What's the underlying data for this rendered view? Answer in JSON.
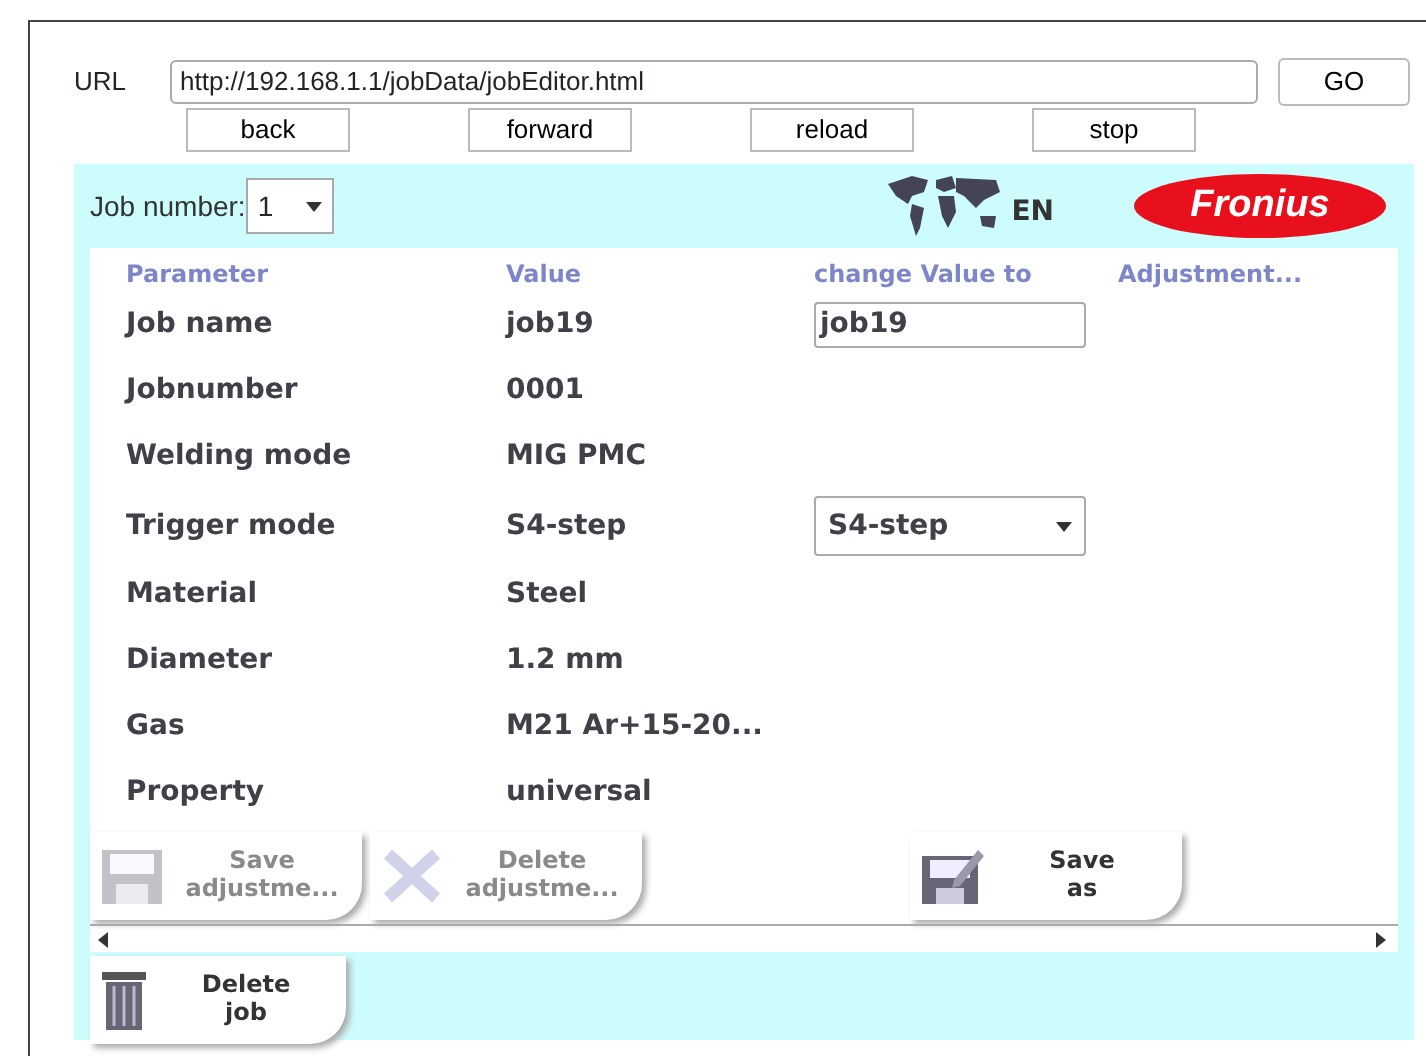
{
  "browser": {
    "url_label": "URL",
    "url": "http://192.168.1.1/jobData/jobEditor.html",
    "go": "GO",
    "nav_buttons": [
      "back",
      "forward",
      "reload",
      "stop"
    ]
  },
  "header": {
    "job_number_label": "Job number:",
    "job_number": "1",
    "language": "EN",
    "logo": "Fronius"
  },
  "table": {
    "columns": [
      "Parameter",
      "Value",
      "change Value to",
      "Adjustment..."
    ],
    "rows": [
      {
        "parameter": "Job name",
        "value": "job19",
        "change": {
          "kind": "text",
          "value": "job19"
        }
      },
      {
        "parameter": "Jobnumber",
        "value": "0001"
      },
      {
        "parameter": "Welding mode",
        "value": "MIG PMC"
      },
      {
        "parameter": "Trigger mode",
        "value": "S4-step",
        "change": {
          "kind": "select",
          "value": "S4-step"
        }
      },
      {
        "parameter": "Material",
        "value": "Steel"
      },
      {
        "parameter": "Diameter",
        "value": "1.2 mm"
      },
      {
        "parameter": "Gas",
        "value": "M21 Ar+15-20..."
      },
      {
        "parameter": "Property",
        "value": "universal"
      }
    ]
  },
  "actions": [
    {
      "kind": "save",
      "lines": [
        "Save",
        "adjustme..."
      ],
      "disabled": true
    },
    {
      "kind": "delete",
      "lines": [
        "Delete",
        "adjustme..."
      ],
      "disabled": true
    },
    {
      "kind": "saveas",
      "lines": [
        "Save",
        "as"
      ],
      "disabled": false
    }
  ],
  "delete_job": {
    "lines": [
      "Delete",
      "job"
    ],
    "disabled": false
  }
}
